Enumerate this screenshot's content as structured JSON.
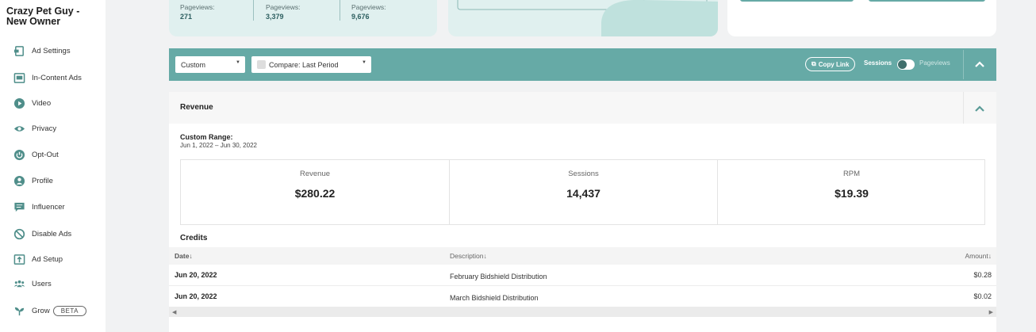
{
  "sidebar": {
    "site_title": "Crazy Pet Guy - New Owner",
    "items": [
      {
        "label": "Ad Settings",
        "icon": "ad-settings-icon"
      },
      {
        "label": "In-Content Ads",
        "icon": "in-content-ads-icon"
      },
      {
        "label": "Video",
        "icon": "video-play-icon"
      },
      {
        "label": "Privacy",
        "icon": "eye-icon"
      },
      {
        "label": "Opt-Out",
        "icon": "power-icon"
      },
      {
        "label": "Profile",
        "icon": "user-icon"
      },
      {
        "label": "Influencer",
        "icon": "chat-icon"
      },
      {
        "label": "Disable Ads",
        "icon": "block-icon"
      },
      {
        "label": "Ad Setup",
        "icon": "upload-icon"
      },
      {
        "label": "Users",
        "icon": "users-icon"
      },
      {
        "label": "Grow",
        "icon": "grow-icon",
        "badge": "BETA"
      }
    ]
  },
  "top_cards": {
    "pageviews": [
      {
        "label": "Pageviews:",
        "value": "271"
      },
      {
        "label": "Pageviews:",
        "value": "3,379"
      },
      {
        "label": "Pageviews:",
        "value": "9,676"
      }
    ]
  },
  "toolbar": {
    "range_select": "Custom",
    "compare_select": "Compare: Last Period",
    "copy_link": "Copy Link",
    "toggle_left": "Sessions",
    "toggle_right": "Pageviews"
  },
  "panel": {
    "title": "Revenue",
    "range_label": "Custom Range:",
    "range_value": "Jun 1, 2022 – Jun 30, 2022",
    "stats": [
      {
        "label": "Revenue",
        "value": "$280.22"
      },
      {
        "label": "Sessions",
        "value": "14,437"
      },
      {
        "label": "RPM",
        "value": "$19.39"
      }
    ],
    "credits_title": "Credits",
    "credits_columns": {
      "date": "Date",
      "description": "Description",
      "amount": "Amount"
    },
    "credits_rows": [
      {
        "date": "Jun 20, 2022",
        "description": "February Bidshield Distribution",
        "amount": "$0.28"
      },
      {
        "date": "Jun 20, 2022",
        "description": "March Bidshield Distribution",
        "amount": "$0.02"
      }
    ]
  },
  "colors": {
    "accent": "#66aaa6",
    "light_card": "#e0f0ef",
    "background": "#f1f2f3"
  }
}
